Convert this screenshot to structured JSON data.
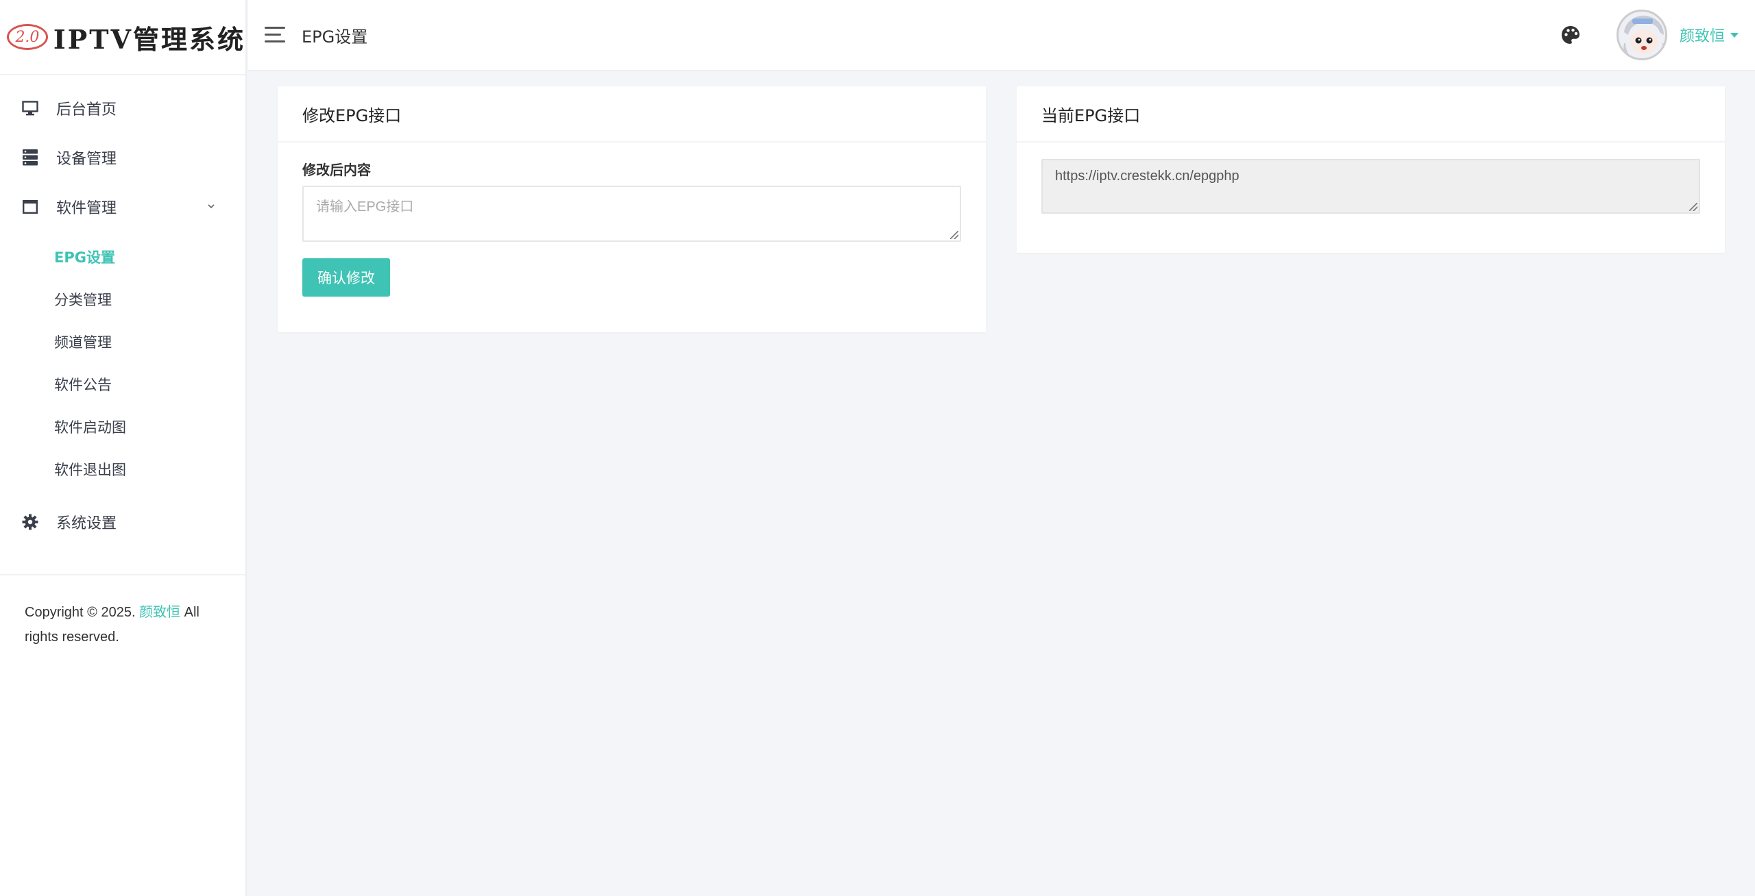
{
  "brand": {
    "badge": "2.0",
    "title": "IPTV管理系统"
  },
  "header": {
    "page_title": "EPG设置",
    "username": "颜致恒"
  },
  "sidebar": {
    "items": [
      {
        "label": "后台首页",
        "icon": "monitor-icon"
      },
      {
        "label": "设备管理",
        "icon": "server-icon"
      },
      {
        "label": "软件管理",
        "icon": "window-icon"
      },
      {
        "label": "系统设置",
        "icon": "gear-icon"
      }
    ],
    "subitems": [
      {
        "label": "EPG设置",
        "active": true
      },
      {
        "label": "分类管理"
      },
      {
        "label": "频道管理"
      },
      {
        "label": "软件公告"
      },
      {
        "label": "软件启动图"
      },
      {
        "label": "软件退出图"
      }
    ],
    "copyright_prefix": "Copyright © 2025. ",
    "copyright_author": "颜致恒",
    "copyright_suffix": " All rights reserved."
  },
  "edit_card": {
    "title": "修改EPG接口",
    "field_label": "修改后内容",
    "placeholder": "请输入EPG接口",
    "button": "确认修改"
  },
  "current_card": {
    "title": "当前EPG接口",
    "value": "https://iptv.crestekk.cn/epgphp"
  },
  "colors": {
    "accent": "#3fc3b4",
    "background": "#f4f5f8"
  }
}
